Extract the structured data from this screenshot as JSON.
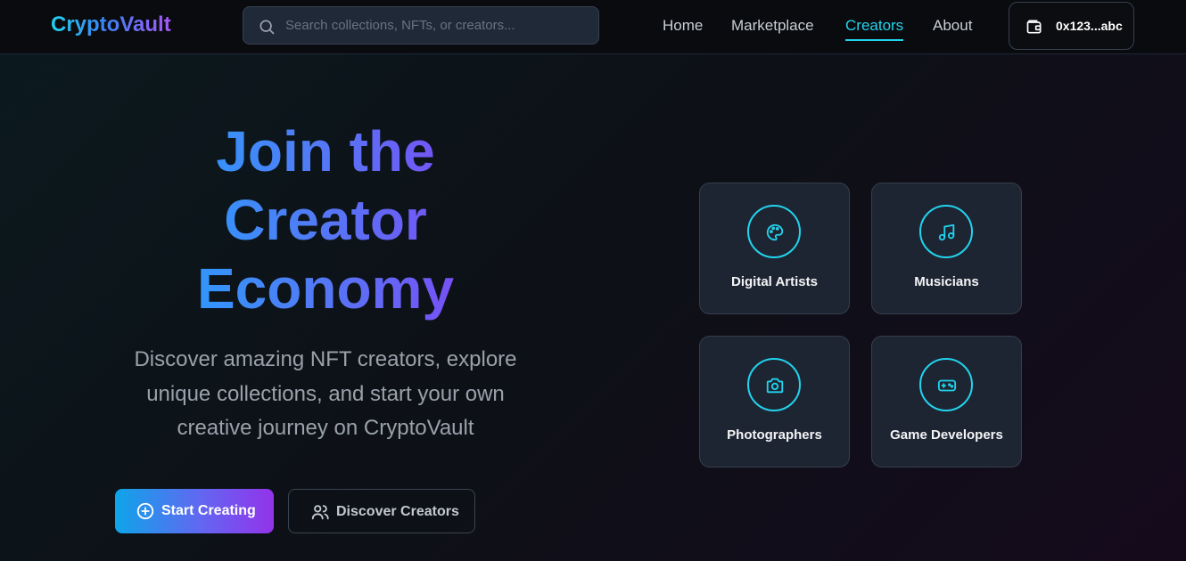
{
  "header": {
    "logo": "CryptoVault",
    "search_placeholder": "Search collections, NFTs, or creators...",
    "nav": [
      "Home",
      "Marketplace",
      "Creators",
      "About"
    ],
    "active_nav": "Creators",
    "wallet_address": "0x123...abc"
  },
  "hero": {
    "title_lines": [
      "Join the",
      "Creator",
      "Economy"
    ],
    "subtitle": "Discover amazing NFT creators, explore unique collections, and start your own creative journey on CryptoVault",
    "primary_button": "Start Creating",
    "secondary_button": "Discover Creators"
  },
  "categories": [
    {
      "label": "Digital Artists",
      "icon": "palette-icon"
    },
    {
      "label": "Musicians",
      "icon": "music-note-icon"
    },
    {
      "label": "Photographers",
      "icon": "camera-icon"
    },
    {
      "label": "Game Developers",
      "icon": "gamepad-icon"
    }
  ],
  "colors": {
    "accent": "#22d3ee",
    "gradient_start": "#0ea5e9",
    "gradient_end": "#9333ea",
    "card_bg": "#1e2532"
  }
}
